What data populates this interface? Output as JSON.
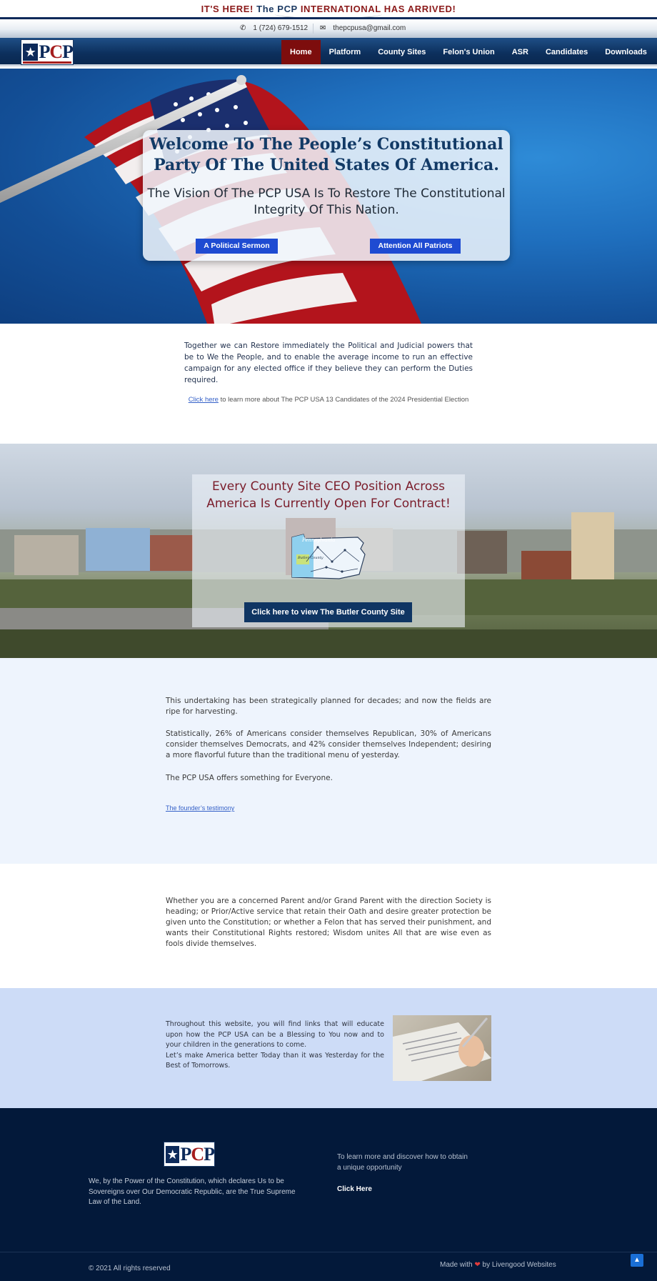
{
  "announcement": {
    "prefix": "IT'S HERE!",
    "middle": "The PCP",
    "suffix": "INTERNATIONAL HAS ARRIVED!"
  },
  "contact": {
    "phone_icon": "phone-icon",
    "phone": "1 (724) 679-1512",
    "email_icon": "envelope-icon",
    "email": "thepcpusa@gmail.com"
  },
  "nav": {
    "logo_text": "PCP",
    "items": [
      {
        "label": "Home",
        "active": true
      },
      {
        "label": "Platform"
      },
      {
        "label": "County Sites"
      },
      {
        "label": "Felon's Union"
      },
      {
        "label": "ASR"
      },
      {
        "label": "Candidates"
      },
      {
        "label": "Downloads"
      }
    ]
  },
  "hero": {
    "title": "Welcome To The People’s Constitutional Party Of The United States Of America.",
    "subtitle": "The Vision Of The PCP USA Is To Restore The Constitutional Integrity Of This Nation.",
    "button_left": "A Political Sermon",
    "button_right": "Attention All Patriots"
  },
  "intro": {
    "paragraph": "Together we can Restore immediately the Political and Judicial powers that be to We the People, and to enable the average income to run an effective campaign for any elected office if they believe they can perform the Duties required.",
    "link_text": "Click here",
    "link_suffix": " to learn more about The PCP USA 13 Candidates of the 2024 Presidential Election"
  },
  "county": {
    "title": "Every County Site CEO Position Across America Is Currently Open For Contract!",
    "map_state_label": "Pennsylvania",
    "map_county_label": "Butler County",
    "button": "Click here to view The Butler County Site"
  },
  "info": {
    "p1": "This undertaking has been strategically planned for decades; and now the fields are ripe for harvesting.",
    "p2": "Statistically, 26% of Americans consider themselves Republican, 30% of Americans consider themselves Democrats, and 42% consider themselves Independent; desiring a more flavorful future than the traditional menu of yesterday.",
    "p3": "The PCP USA offers something for Everyone.",
    "link": "The founder’s testimony"
  },
  "parent": {
    "paragraph": "Whether you are a concerned Parent and/or Grand Parent with the direction Society is heading; or Prior/Active service that retain their Oath and desire greater protection be given unto the Constitution; or whether a Felon that has served their punishment, and wants their Constitutional Rights restored; Wisdom unites All that are wise even as fools divide themselves."
  },
  "bless": {
    "p1": "Throughout this website, you will find links that will educate upon how the PCP USA can be a Blessing to You now and to your children in the generations to come.",
    "p2": "Let’s make America better Today than it was Yesterday for the Best of Tomorrows."
  },
  "footer": {
    "tagline": "We, by the Power of the Constitution, which declares Us to be Sovereigns over Our Democratic Republic, are the True Supreme Law of the Land.",
    "learn_more": "To learn more and discover how to obtain a unique opportunity",
    "click_here": "Click Here",
    "copyright": "© 2021 All rights reserved",
    "made_prefix": "Made with ",
    "made_suffix": " by Livengood Websites",
    "heart_icon": "heart-icon",
    "scroll_icon": "chevron-up-icon"
  },
  "colors": {
    "navy": "#0d2a5a",
    "crimson": "#7d0d0d",
    "button_blue": "#1e4bd2",
    "footer_bg": "#03193a"
  }
}
